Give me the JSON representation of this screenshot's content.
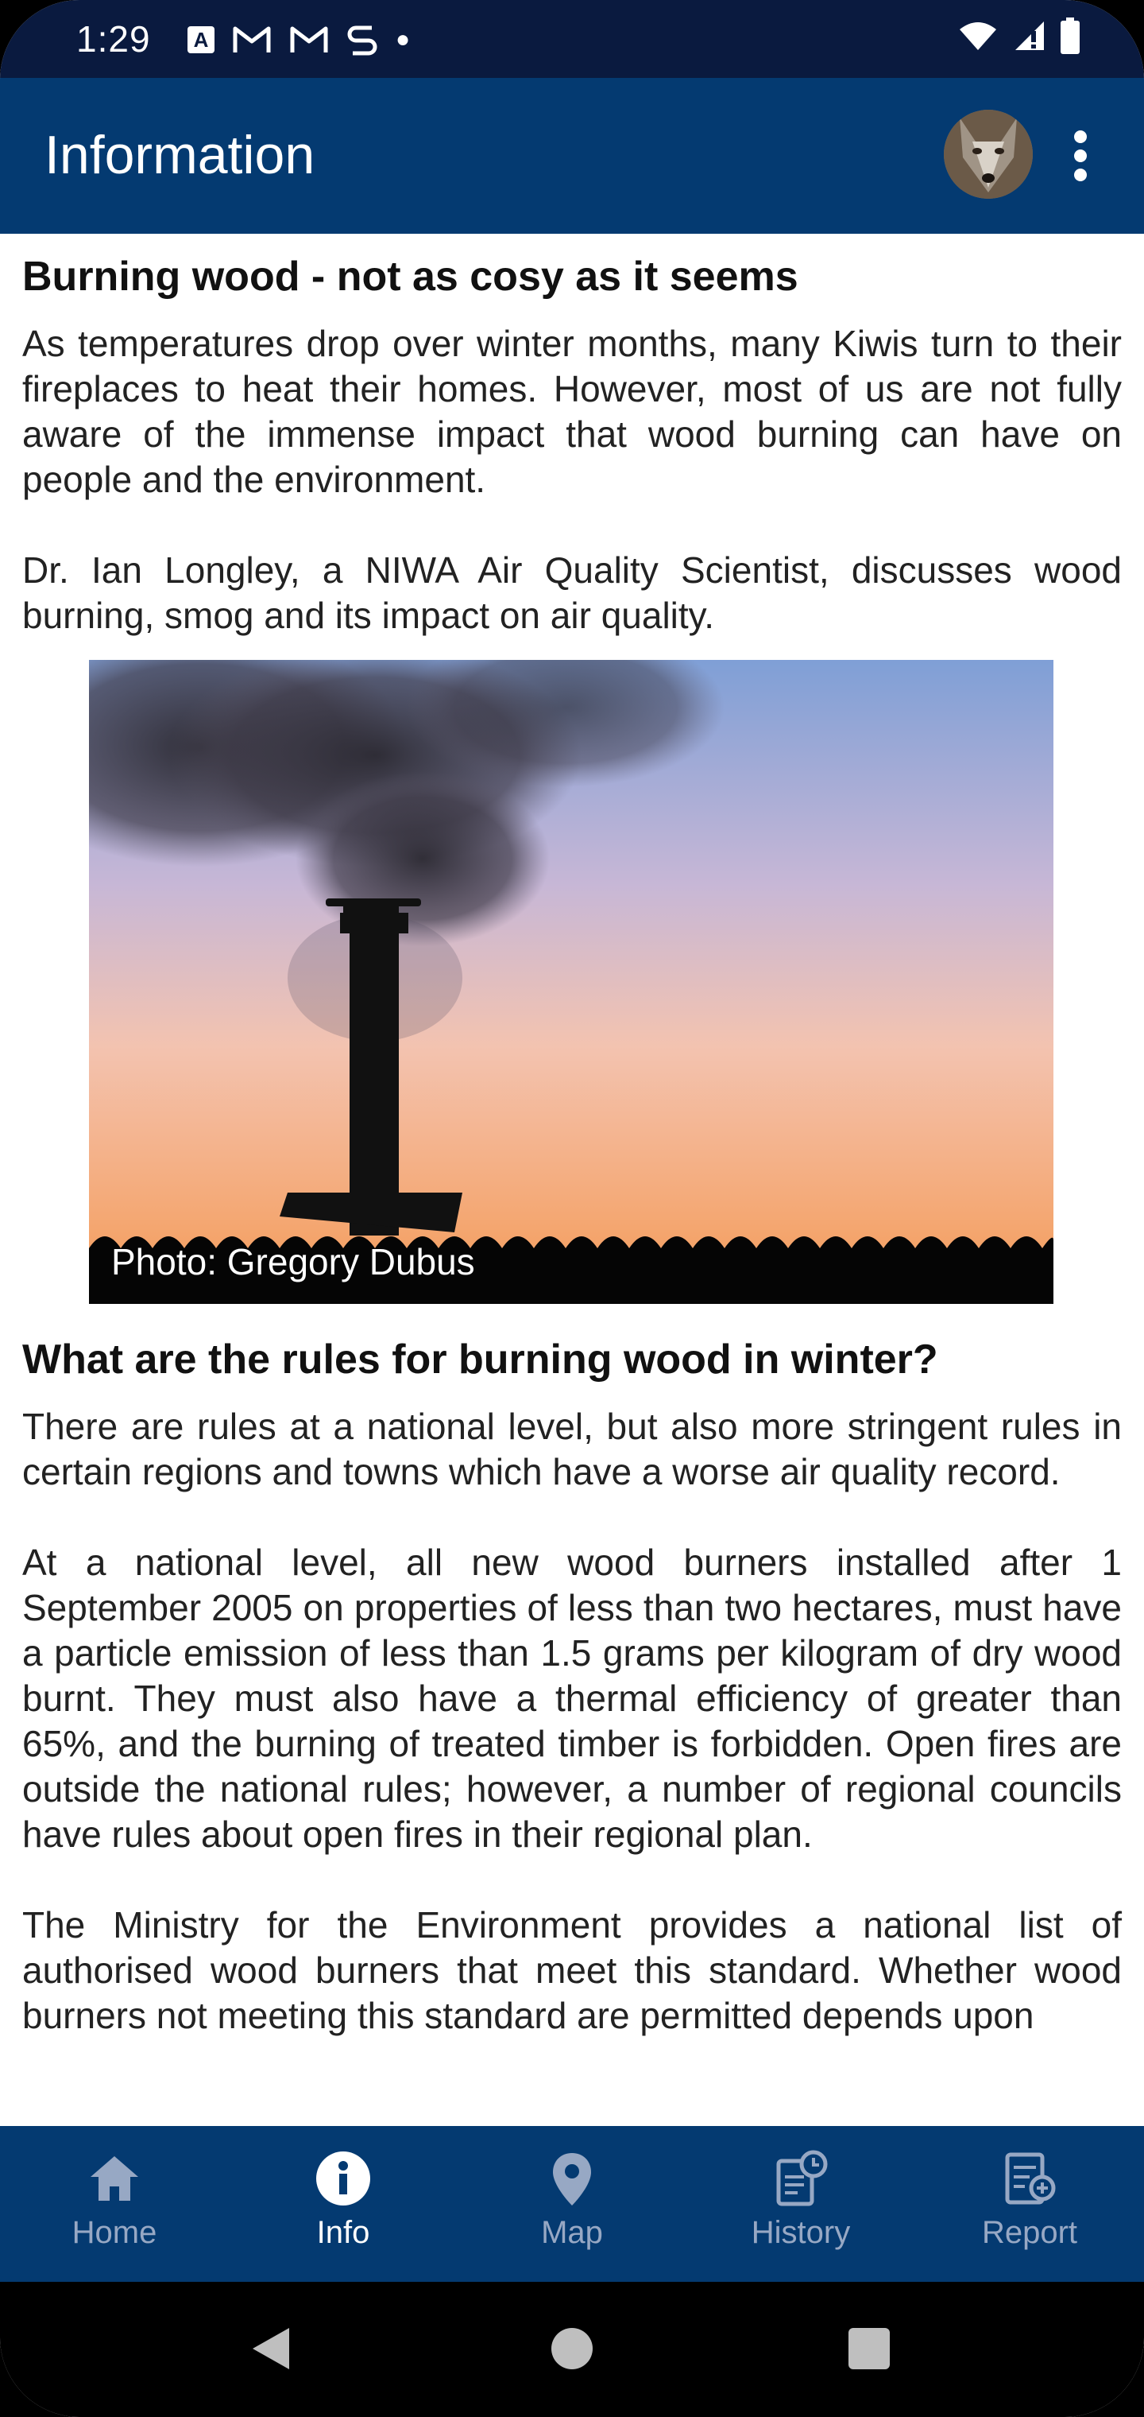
{
  "status": {
    "time": "1:29",
    "notif_icons": [
      "a-box-icon",
      "gmail-icon",
      "gmail-icon",
      "sync-icon",
      "dot-icon"
    ],
    "right_icons": [
      "wifi-icon",
      "signal-icon",
      "battery-icon"
    ]
  },
  "appbar": {
    "title": "Information",
    "avatar_icon": "wolf-avatar",
    "menu_icon": "more-vert-icon"
  },
  "article": {
    "heading1": "Burning wood - not as cosy as it seems",
    "para1": "As temperatures drop over winter months, many Kiwis turn to their fireplaces to heat their homes. However, most of us are not fully aware of the immense impact that wood burning can have on people and the environment.",
    "para2": "Dr. Ian Longley, a NIWA Air Quality Scientist, discusses wood burning, smog and its impact on air quality.",
    "photo_caption": "Photo: Gregory Dubus",
    "heading2": "What are the rules for burning wood in winter?",
    "para3": "There are rules at a national level, but also more stringent rules in certain regions and towns which have a worse air quality record.",
    "para4": "At a national level, all new wood burners installed after 1 September 2005 on properties of less than two hectares, must have a particle emission of less than 1.5 grams per kilogram of dry wood burnt. They must also have a thermal efficiency of greater than 65%, and the burning of treated timber is forbidden. Open fires are outside the national rules; however, a number of regional councils have rules about open fires in their regional plan.",
    "para5": "The Ministry for the Environment provides a national list of authorised wood burners that meet this standard. Whether wood burners not meeting this standard are permitted depends upon"
  },
  "nav": {
    "items": [
      {
        "label": "Home",
        "icon": "home-icon",
        "active": false
      },
      {
        "label": "Info",
        "icon": "info-icon",
        "active": true
      },
      {
        "label": "Map",
        "icon": "map-pin-icon",
        "active": false
      },
      {
        "label": "History",
        "icon": "history-icon",
        "active": false
      },
      {
        "label": "Report",
        "icon": "report-icon",
        "active": false
      }
    ]
  },
  "colors": {
    "appbar": "#043a71",
    "statusbar": "#0a1a3f",
    "nav_inactive": "#97a8c4",
    "nav_active": "#ffffff"
  }
}
